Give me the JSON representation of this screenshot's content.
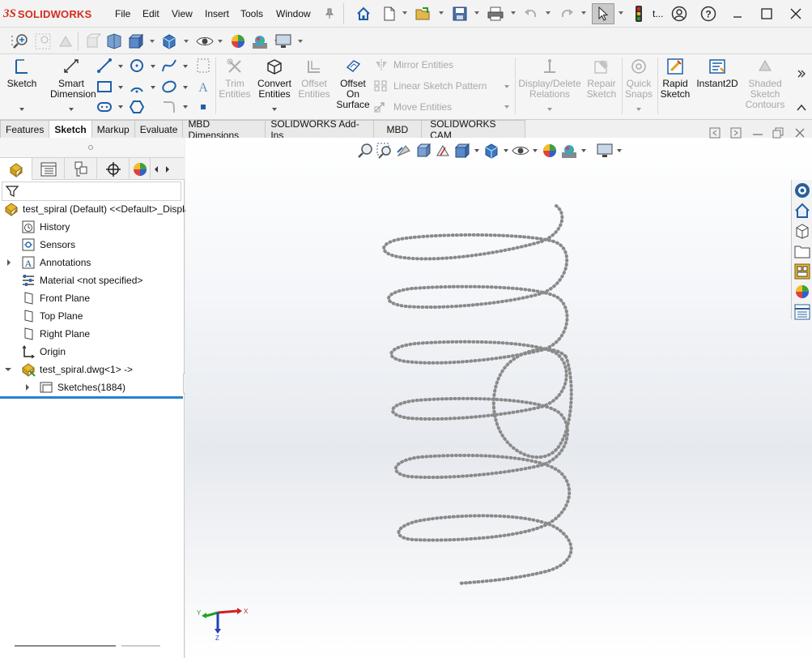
{
  "app": {
    "brand_prefix": "3S",
    "brand_name": "SOLIDWORKS",
    "window_title_truncated": "t..."
  },
  "menu": [
    "File",
    "Edit",
    "View",
    "Insert",
    "Tools",
    "Window"
  ],
  "command_manager": {
    "sketch": "Sketch",
    "smart_dimension_1": "Smart",
    "smart_dimension_2": "Dimension",
    "trim_1": "Trim",
    "trim_2": "Entities",
    "convert_1": "Convert",
    "convert_2": "Entities",
    "offset_1": "Offset",
    "offset_2": "Entities",
    "offset_surface_1": "Offset",
    "offset_surface_2": "On",
    "offset_surface_3": "Surface",
    "mirror": "Mirror Entities",
    "linear_pattern": "Linear Sketch Pattern",
    "move": "Move Entities",
    "display_delete_1": "Display/Delete",
    "display_delete_2": "Relations",
    "repair_1": "Repair",
    "repair_2": "Sketch",
    "quick_snaps_1": "Quick",
    "quick_snaps_2": "Snaps",
    "rapid_1": "Rapid",
    "rapid_2": "Sketch",
    "instant2d": "Instant2D",
    "shaded_1": "Shaded",
    "shaded_2": "Sketch",
    "shaded_3": "Contours"
  },
  "tabs": [
    "Features",
    "Sketch",
    "Markup",
    "Evaluate",
    "MBD Dimensions",
    "SOLIDWORKS Add-Ins",
    "MBD",
    "SOLIDWORKS CAM"
  ],
  "active_tab": "Sketch",
  "feature_tree": {
    "root": "test_spiral (Default) <<Default>_Displa",
    "history": "History",
    "sensors": "Sensors",
    "annotations": "Annotations",
    "material": "Material <not specified>",
    "front_plane": "Front Plane",
    "top_plane": "Top Plane",
    "right_plane": "Right Plane",
    "origin": "Origin",
    "dwg": "test_spiral.dwg<1> ->",
    "sketches": "Sketches(1884)"
  },
  "triad": {
    "x": "X",
    "y": "Y",
    "z": "Z"
  },
  "colors": {
    "accent_red": "#d52b1e",
    "spiral": "#8a8a8a",
    "tree_line": "#2a7fd0"
  }
}
